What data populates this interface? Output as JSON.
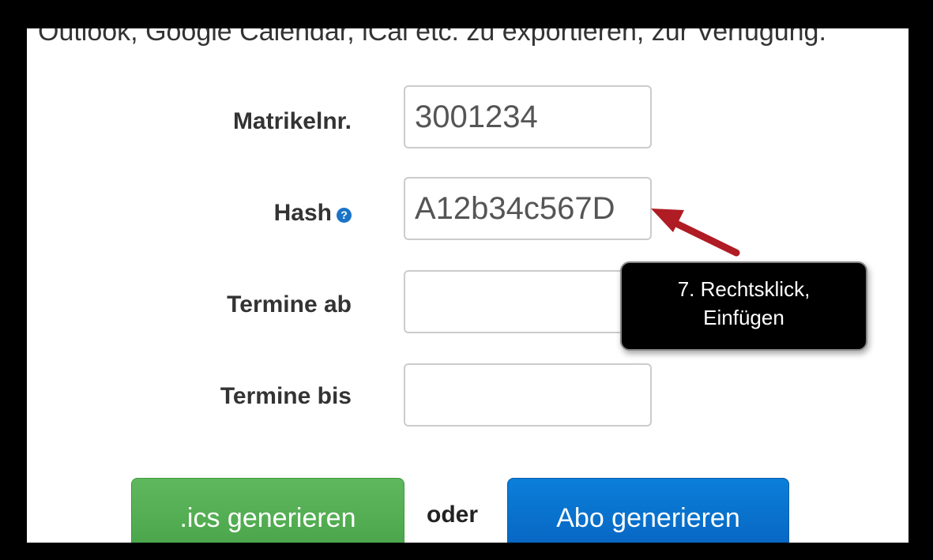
{
  "intro_text": "Outlook, Google Calendar, iCal etc. zu exportieren, zur Verfügung.",
  "form": {
    "matrikel": {
      "label": "Matrikelnr.",
      "value": "3001234"
    },
    "hash": {
      "label": "Hash",
      "value": "A12b34c567D",
      "help_icon": "?"
    },
    "termine_ab": {
      "label": "Termine ab",
      "value": ""
    },
    "termine_bis": {
      "label": "Termine bis",
      "value": ""
    }
  },
  "buttons": {
    "ics": ".ics generieren",
    "separator": "oder",
    "abo": "Abo generieren"
  },
  "tooltip": {
    "line1": "7. Rechtsklick,",
    "line2": "Einfügen"
  },
  "colors": {
    "green_button": "#5cb85c",
    "blue_button": "#0a74d2",
    "annotation_arrow": "#b01c24",
    "help_icon": "#1a73c6"
  }
}
